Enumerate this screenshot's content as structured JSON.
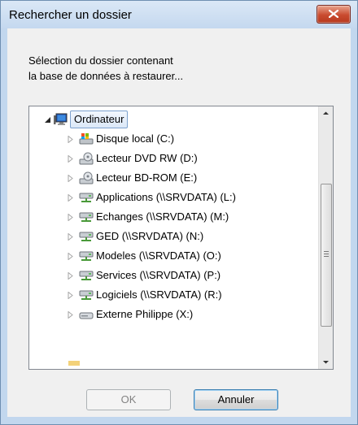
{
  "window": {
    "title": "Rechercher un dossier"
  },
  "description": {
    "line1": "Sélection du dossier contenant",
    "line2": "la base de données à restaurer..."
  },
  "tree": {
    "root": {
      "label": "Ordinateur",
      "icon": "computer-icon"
    },
    "items": [
      {
        "label": "Disque local (C:)",
        "icon": "local-disk-icon"
      },
      {
        "label": "Lecteur DVD RW (D:)",
        "icon": "dvd-drive-icon"
      },
      {
        "label": "Lecteur BD-ROM (E:)",
        "icon": "bd-drive-icon"
      },
      {
        "label": "Applications (\\\\SRVDATA) (L:)",
        "icon": "network-drive-icon"
      },
      {
        "label": "Echanges (\\\\SRVDATA) (M:)",
        "icon": "network-drive-icon"
      },
      {
        "label": "GED (\\\\SRVDATA) (N:)",
        "icon": "network-drive-icon"
      },
      {
        "label": "Modeles (\\\\SRVDATA) (O:)",
        "icon": "network-drive-icon"
      },
      {
        "label": "Services (\\\\SRVDATA) (P:)",
        "icon": "network-drive-icon"
      },
      {
        "label": "Logiciels (\\\\SRVDATA) (R:)",
        "icon": "network-drive-icon"
      },
      {
        "label": "Externe Philippe (X:)",
        "icon": "removable-drive-icon"
      }
    ]
  },
  "buttons": {
    "ok": "OK",
    "cancel": "Annuler"
  },
  "colors": {
    "titlebar": "#c4d8ef",
    "close": "#c94b2f",
    "network_drive": "#5cb85c"
  }
}
